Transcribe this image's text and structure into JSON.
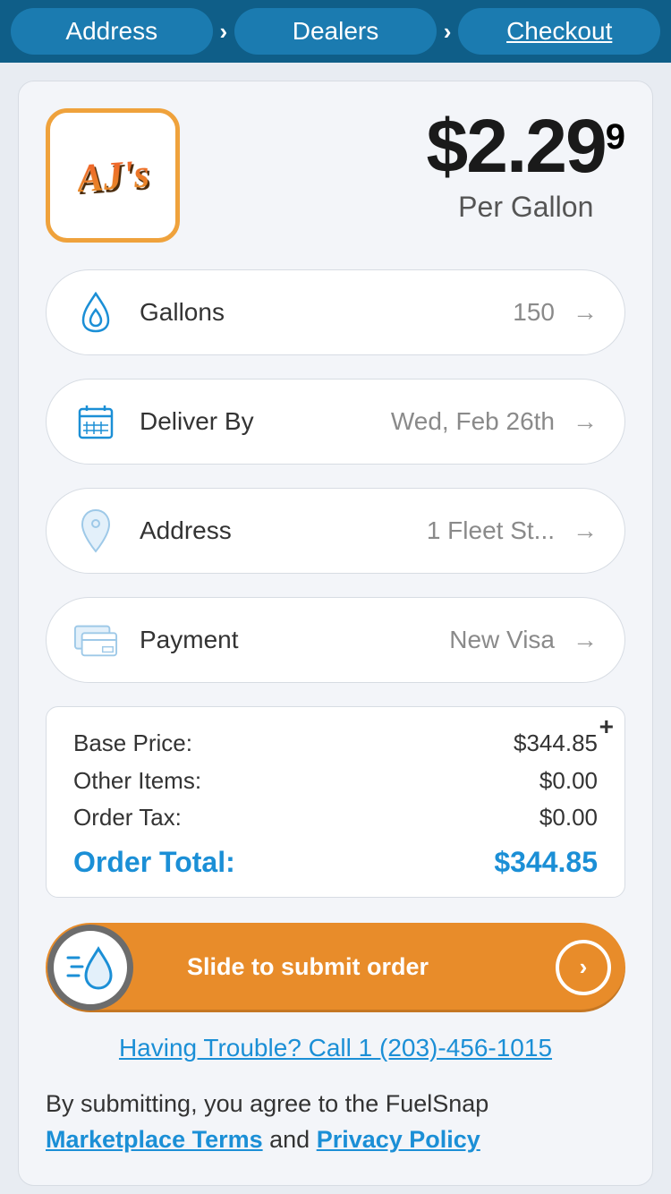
{
  "breadcrumb": {
    "items": [
      "Address",
      "Dealers",
      "Checkout"
    ],
    "activeIndex": 2
  },
  "dealer": {
    "name": "AJ's"
  },
  "price": {
    "main": "$2.29",
    "super": "9",
    "sub": "Per Gallon"
  },
  "rows": {
    "gallons": {
      "label": "Gallons",
      "value": "150"
    },
    "deliver": {
      "label": "Deliver By",
      "value": "Wed, Feb 26th"
    },
    "address": {
      "label": "Address",
      "value": "1 Fleet St..."
    },
    "payment": {
      "label": "Payment",
      "value": "New Visa"
    }
  },
  "summary": {
    "basePriceLabel": "Base Price:",
    "basePriceValue": "$344.85",
    "otherLabel": "Other Items:",
    "otherValue": "$0.00",
    "taxLabel": "Order Tax:",
    "taxValue": "$0.00",
    "totalLabel": "Order Total:",
    "totalValue": "$344.85"
  },
  "slider": {
    "label": "Slide to submit order"
  },
  "trouble": {
    "text": "Having Trouble? Call 1 (203)-456-1015"
  },
  "terms": {
    "prefix": "By submitting, you agree to the FuelSnap ",
    "link1": "Marketplace Terms",
    "middle": " and ",
    "link2": "Privacy Policy"
  }
}
